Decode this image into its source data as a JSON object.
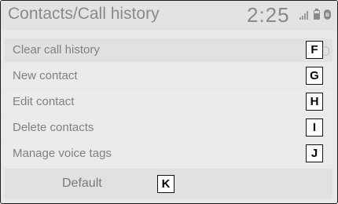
{
  "header": {
    "title": "Contacts/Call history",
    "clock": "2:25",
    "status_icons": [
      "signal-icon",
      "battery-icon",
      "bluetooth-icon"
    ]
  },
  "menu": {
    "items": [
      {
        "label": "Clear call history",
        "callout": "F"
      },
      {
        "label": "New contact",
        "callout": "G"
      },
      {
        "label": "Edit contact",
        "callout": "H"
      },
      {
        "label": "Delete contacts",
        "callout": "I"
      },
      {
        "label": "Manage voice tags",
        "callout": "J"
      }
    ]
  },
  "default_button": {
    "label": "Default",
    "callout": "K"
  },
  "colors": {
    "background": "#e9e9e9",
    "text": "#808080",
    "callout_border": "#111111"
  }
}
